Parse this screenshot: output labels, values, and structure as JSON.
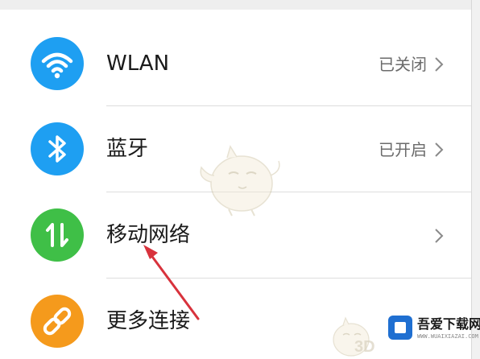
{
  "settings": {
    "items": [
      {
        "label": "WLAN",
        "status": "已关闭",
        "icon": "wifi-icon",
        "icon_color": "#1e9ff2"
      },
      {
        "label": "蓝牙",
        "status": "已开启",
        "icon": "bluetooth-icon",
        "icon_color": "#1e9ff2"
      },
      {
        "label": "移动网络",
        "status": "",
        "icon": "mobile-data-icon",
        "icon_color": "#3fbf47"
      },
      {
        "label": "更多连接",
        "status": "",
        "icon": "link-icon",
        "icon_color": "#f59a1c"
      }
    ]
  },
  "annotation": {
    "arrow_color": "#d8323c"
  },
  "watermark": {
    "brand_name": "吾爱下载网",
    "brand_url": "WWW.WUAIXIAZAI.COM",
    "brand_color": "#1f6fd1",
    "small_text": "3D"
  }
}
